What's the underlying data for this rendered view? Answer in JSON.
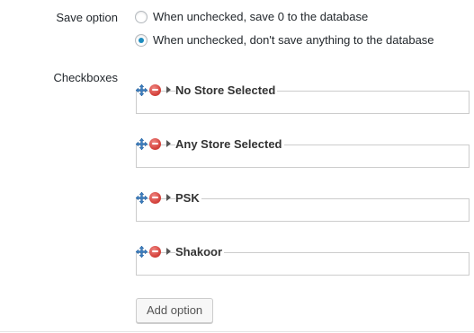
{
  "save_option": {
    "label": "Save option",
    "options": [
      {
        "text": "When unchecked, save 0 to the database",
        "selected": false
      },
      {
        "text": "When unchecked, don't save anything to the database",
        "selected": true
      }
    ]
  },
  "checkboxes": {
    "label": "Checkboxes",
    "items": [
      {
        "title": "No Store Selected"
      },
      {
        "title": "Any Store Selected"
      },
      {
        "title": "PSK"
      },
      {
        "title": "Shakoor"
      }
    ],
    "add_button": "Add option"
  },
  "colors": {
    "radio_selected": "#1e8cbe",
    "remove_icon": "#d6453f"
  },
  "icons": [
    "move-icon",
    "remove-icon",
    "expand-arrow-icon"
  ]
}
